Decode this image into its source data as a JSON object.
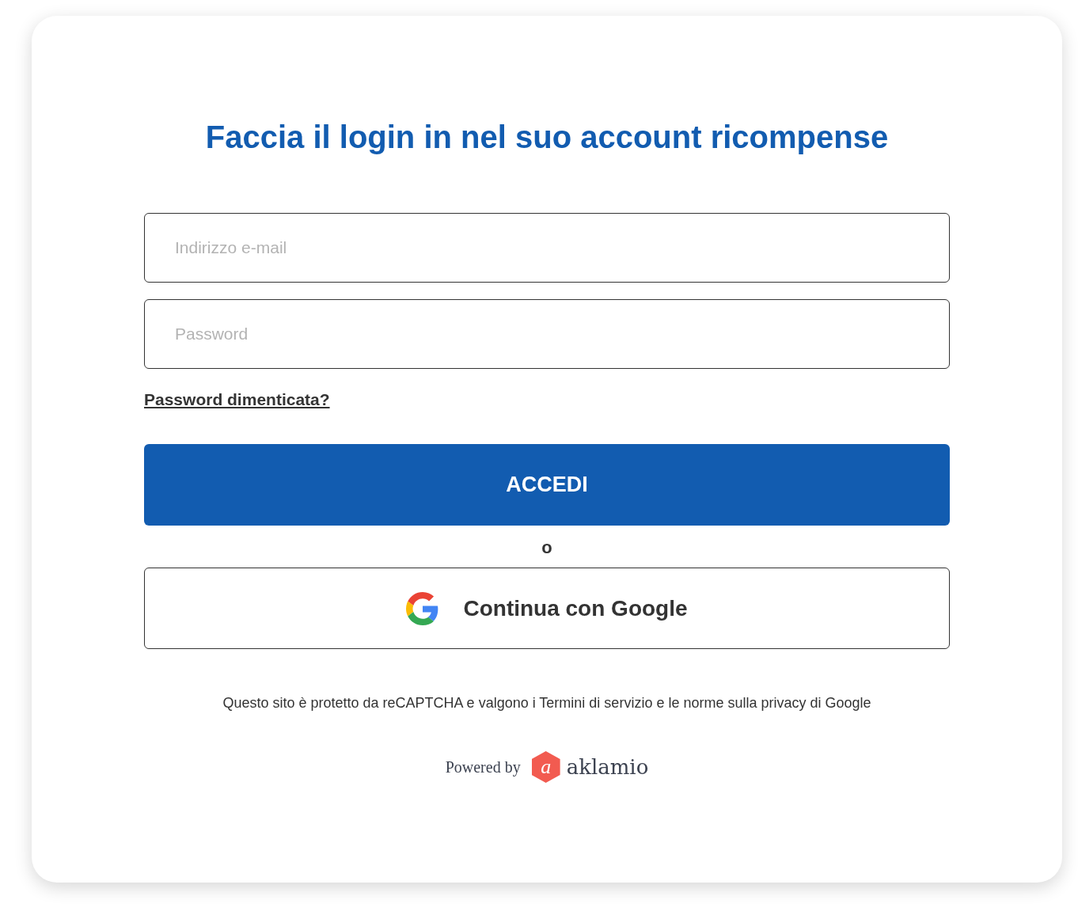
{
  "title": "Faccia il login in nel suo account ricompense",
  "fields": [
    {
      "placeholder": "Indirizzo e-mail"
    },
    {
      "placeholder": "Password"
    }
  ],
  "forgot_link": "Password dimenticata?",
  "submit_button": "ACCEDI",
  "separator": "o",
  "google_button": "Continua con Google",
  "legal_note": "Questo sito è protetto da reCAPTCHA e valgono i Termini di servizio e le norme sulla privacy di Google",
  "powered_by": {
    "label": "Powered by",
    "logo_mark": "a",
    "brand": "aklamio"
  }
}
